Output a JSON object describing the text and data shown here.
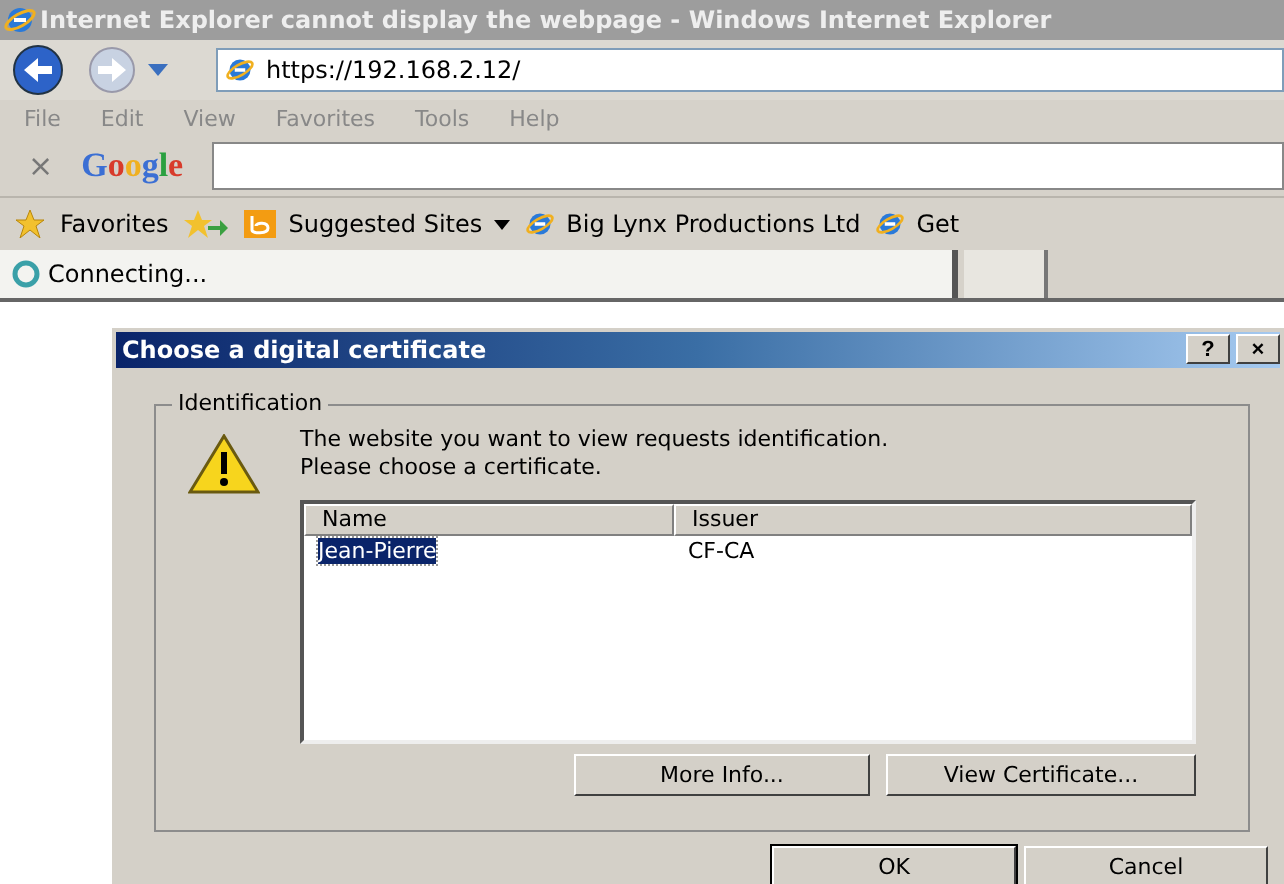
{
  "window": {
    "title": "Internet Explorer cannot display the webpage - Windows Internet Explorer"
  },
  "address": {
    "value": "https://192.168.2.12/"
  },
  "menu": [
    "File",
    "Edit",
    "View",
    "Favorites",
    "Tools",
    "Help"
  ],
  "google_bar": {
    "close": "×",
    "logo": "Google"
  },
  "favorites_bar": {
    "favorites": "Favorites",
    "items": [
      {
        "label": "Suggested Sites",
        "kind": "dropdown"
      },
      {
        "label": "Big Lynx Productions Ltd",
        "kind": "page"
      },
      {
        "label": "Get",
        "kind": "page"
      }
    ]
  },
  "tab": {
    "label": "Connecting..."
  },
  "dialog": {
    "title": "Choose a digital certificate",
    "help": "?",
    "close": "×",
    "group": "Identification",
    "message": "The website you want to view requests identification.\nPlease choose a certificate.",
    "columns": [
      "Name",
      "Issuer"
    ],
    "rows": [
      {
        "cells": [
          "Jean-Pierre",
          "CF-CA"
        ],
        "selected": true
      }
    ],
    "group_buttons": [
      "More Info...",
      "View Certificate..."
    ],
    "buttons": [
      {
        "label": "OK",
        "default": true
      },
      {
        "label": "Cancel",
        "default": false
      }
    ]
  }
}
